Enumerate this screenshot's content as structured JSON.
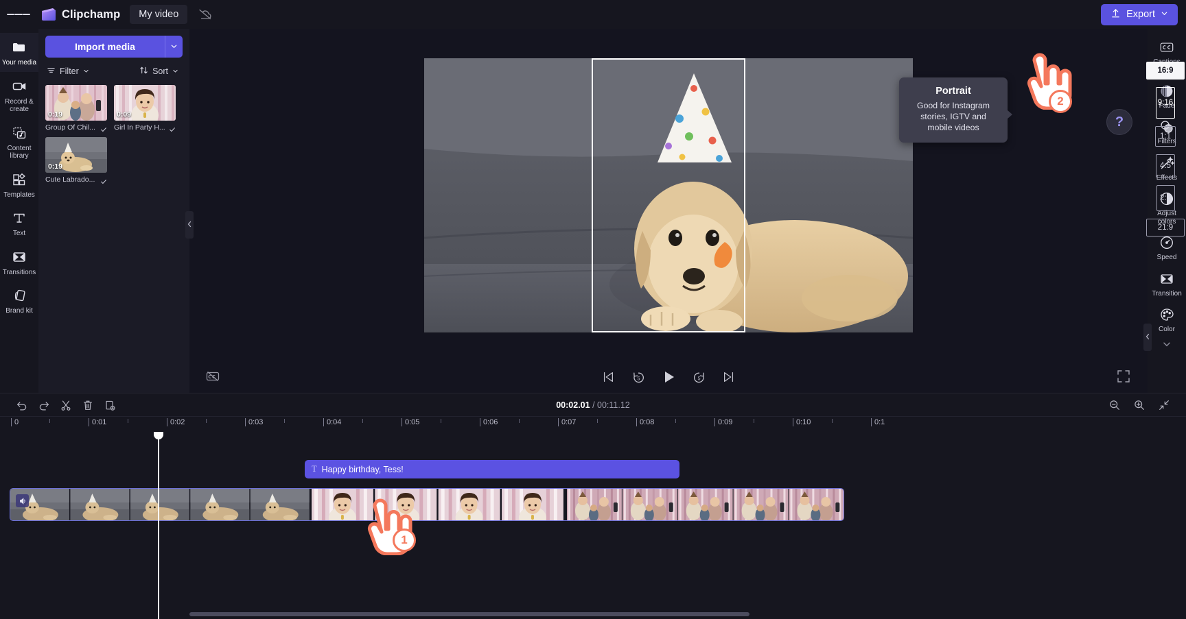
{
  "topbar": {
    "menu_icon": "hamburger-icon",
    "brand": "Clipchamp",
    "project_name": "My video",
    "sync_icon": "cloud-off-icon",
    "export_label": "Export",
    "export_icon": "upload-icon",
    "export_caret": "chevron-down-icon",
    "accent": "#5a52e0"
  },
  "left_rail": {
    "items": [
      {
        "label": "Your media",
        "icon": "folder-icon",
        "active": true
      },
      {
        "label": "Record & create",
        "icon": "video-camera-icon",
        "active": false
      },
      {
        "label": "Content library",
        "icon": "media-library-icon",
        "active": false
      },
      {
        "label": "Templates",
        "icon": "templates-grid-icon",
        "active": false
      },
      {
        "label": "Text",
        "icon": "text-t-icon",
        "active": false
      },
      {
        "label": "Transitions",
        "icon": "transitions-icon",
        "active": false
      },
      {
        "label": "Brand kit",
        "icon": "brand-kit-icon",
        "active": false
      }
    ]
  },
  "media_panel": {
    "import_label": "Import media",
    "import_caret_icon": "chevron-down-icon",
    "filter_label": "Filter",
    "filter_icon": "filter-lines-icon",
    "filter_caret_icon": "chevron-down-icon",
    "sort_label": "Sort",
    "sort_icon": "sort-arrows-icon",
    "sort_caret_icon": "chevron-down-icon",
    "collapse_icon": "chevron-left-icon",
    "items": [
      {
        "name": "Group Of Chil...",
        "duration": "0:19",
        "check_icon": "check-icon"
      },
      {
        "name": "Girl In Party H...",
        "duration": "0:09",
        "check_icon": "check-icon"
      },
      {
        "name": "Cute Labrado...",
        "duration": "0:19",
        "check_icon": "check-icon"
      }
    ]
  },
  "preview": {
    "cc_icon": "closed-captions-off-icon",
    "controls": [
      {
        "name": "skip-to-start",
        "icon": "skip-start-icon"
      },
      {
        "name": "rewind-5",
        "icon": "rewind-5-icon"
      },
      {
        "name": "play",
        "icon": "play-icon"
      },
      {
        "name": "forward-5",
        "icon": "forward-5-icon"
      },
      {
        "name": "skip-to-end",
        "icon": "skip-end-icon"
      }
    ],
    "fullscreen_icon": "fullscreen-icon"
  },
  "aspect_ratios": {
    "options": [
      {
        "label": "16:9",
        "selected": true
      },
      {
        "label": "9:16",
        "selected": false
      },
      {
        "label": "1:1",
        "selected": false
      },
      {
        "label": "4:5",
        "selected": false
      },
      {
        "label": "2:3",
        "selected": false
      },
      {
        "label": "21:9",
        "selected": false
      }
    ]
  },
  "tooltip": {
    "title": "Portrait",
    "body": "Good for Instagram stories, IGTV and mobile videos"
  },
  "right_rail": {
    "items": [
      {
        "label": "Captions",
        "icon": "cc-icon"
      },
      {
        "label": "Fade",
        "icon": "fade-icon"
      },
      {
        "label": "Filters",
        "icon": "filters-icon"
      },
      {
        "label": "Effects",
        "icon": "effects-wand-icon"
      },
      {
        "label": "Adjust colors",
        "icon": "adjust-colors-icon"
      },
      {
        "label": "Speed",
        "icon": "speed-gauge-icon"
      },
      {
        "label": "Transition",
        "icon": "transition-icon"
      },
      {
        "label": "Color",
        "icon": "color-palette-icon"
      }
    ],
    "more_icon": "chevron-down-icon",
    "collapse_icon": "chevron-left-icon"
  },
  "help": {
    "label": "?",
    "icon": "help-question-icon"
  },
  "timeline": {
    "tools": [
      {
        "name": "undo",
        "icon": "undo-icon"
      },
      {
        "name": "redo",
        "icon": "redo-icon"
      },
      {
        "name": "split",
        "icon": "scissors-icon"
      },
      {
        "name": "delete",
        "icon": "trash-icon"
      },
      {
        "name": "duplicate",
        "icon": "duplicate-icon"
      }
    ],
    "current_time": "00:02.01",
    "separator": "/",
    "total_time": "00:11.12",
    "zoom_out_icon": "zoom-out-icon",
    "zoom_in_icon": "zoom-in-icon",
    "fit_icon": "fit-to-screen-icon",
    "ruler_labels": [
      "0",
      "0:01",
      "0:02",
      "0:03",
      "0:04",
      "0:05",
      "0:06",
      "0:07",
      "0:08",
      "0:09",
      "0:10",
      "0:1"
    ],
    "text_clip": {
      "label": "Happy birthday, Tess!",
      "icon": "text-t-icon",
      "color": "#5b52e2"
    },
    "video_clips": [
      {
        "name": "Cute Labrador puppy clip",
        "audio_icon": "speaker-icon"
      },
      {
        "name": "Girl in party hat clip"
      },
      {
        "name": "Group of children clip"
      }
    ],
    "playhead_time": "00:02.01"
  },
  "annotations": [
    {
      "badge": "1",
      "target": "timeline-video-clip"
    },
    {
      "badge": "2",
      "target": "aspect-ratio-9-16"
    }
  ]
}
